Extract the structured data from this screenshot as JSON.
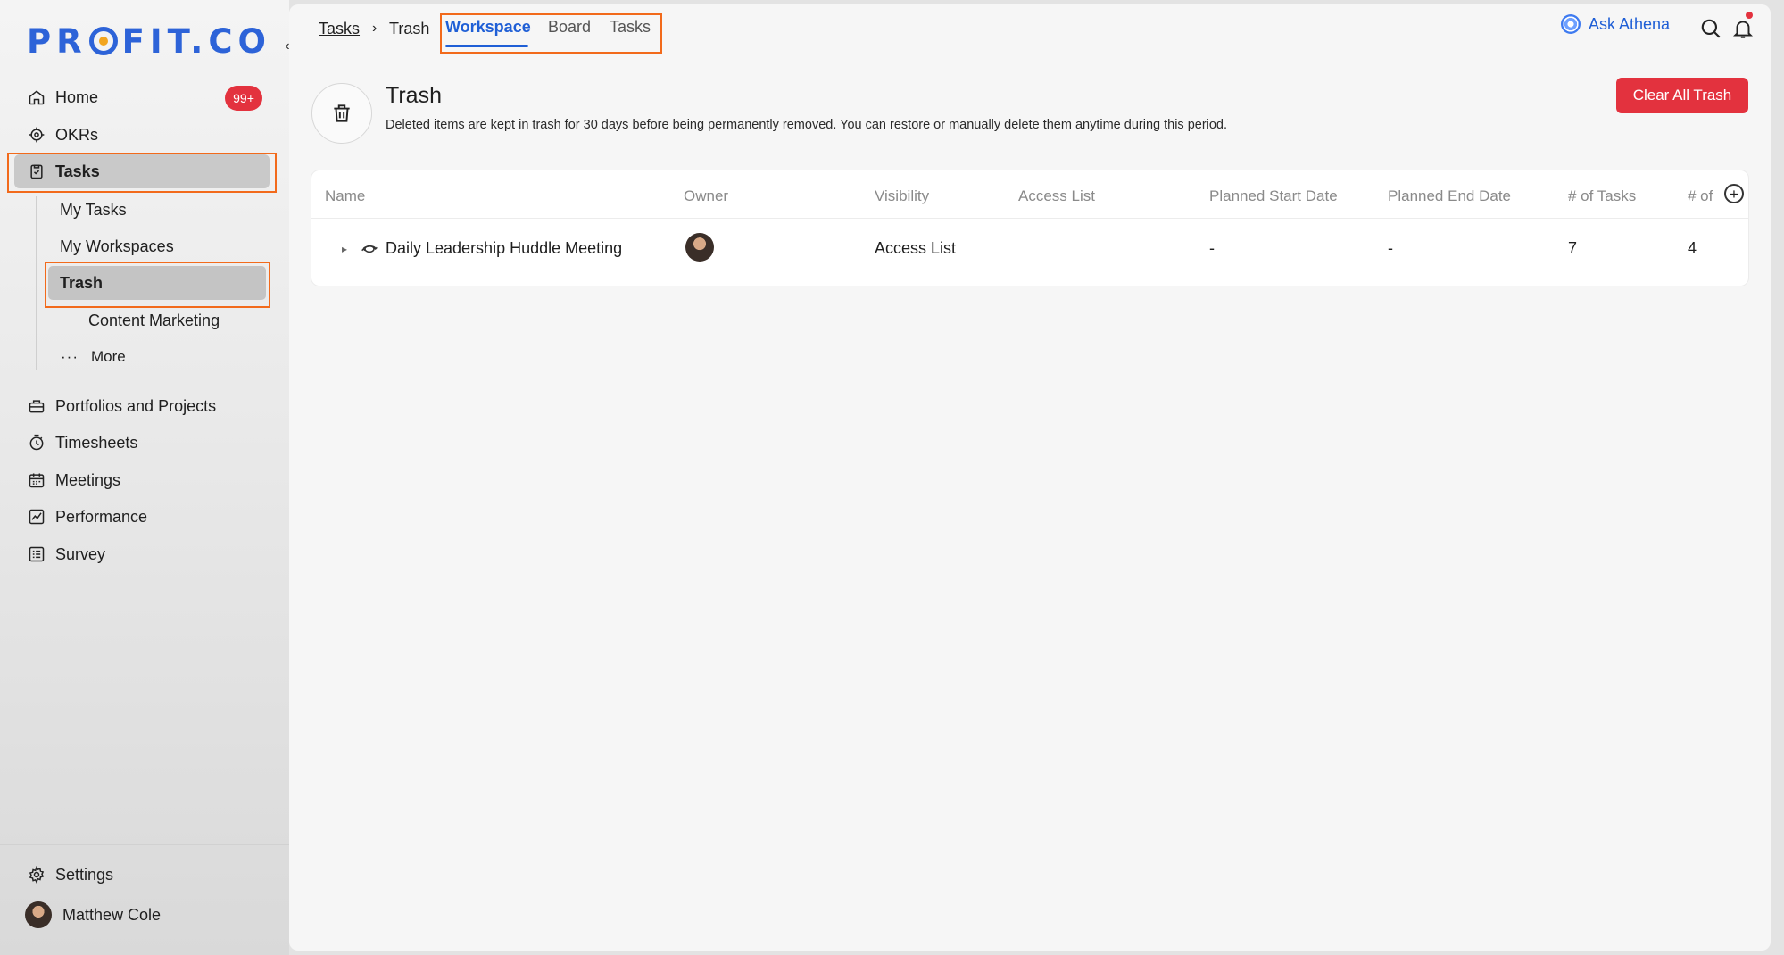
{
  "brand": {
    "logo_pre": "PR",
    "logo_post": "FIT.CO"
  },
  "sidebar": {
    "collapse": "‹",
    "items": [
      {
        "label": "Home",
        "icon": "home-icon",
        "badge": "99+"
      },
      {
        "label": "OKRs",
        "icon": "target-icon"
      },
      {
        "label": "Tasks",
        "icon": "clipboard-check-icon"
      }
    ],
    "task_subitems": [
      {
        "label": "My Tasks"
      },
      {
        "label": "My Workspaces"
      },
      {
        "label": "Trash"
      },
      {
        "label": "Content Marketing"
      },
      {
        "label": "More"
      }
    ],
    "more_items": [
      {
        "label": "Portfolios and Projects",
        "icon": "briefcase-icon"
      },
      {
        "label": "Timesheets",
        "icon": "stopwatch-icon"
      },
      {
        "label": "Meetings",
        "icon": "calendar-icon"
      },
      {
        "label": "Performance",
        "icon": "chart-line-icon"
      },
      {
        "label": "Survey",
        "icon": "survey-icon"
      }
    ],
    "settings": "Settings",
    "user": "Matthew Cole"
  },
  "topbar": {
    "breadcrumb": {
      "root": "Tasks",
      "separator": "›",
      "current": "Trash"
    },
    "tabs": [
      {
        "label": "Workspace",
        "active": true
      },
      {
        "label": "Board"
      },
      {
        "label": "Tasks"
      }
    ],
    "ask_athena": "Ask Athena"
  },
  "page": {
    "title": "Trash",
    "description": "Deleted items are kept in trash for 30 days before being permanently removed. You can restore or manually delete them anytime during this period.",
    "clear_all": "Clear All Trash"
  },
  "table": {
    "columns": [
      "Name",
      "Owner",
      "Visibility",
      "Access List",
      "Planned Start Date",
      "Planned End Date",
      "# of Tasks",
      "# of"
    ],
    "add_column": "+",
    "rows": [
      {
        "name": "Daily Leadership Huddle Meeting",
        "visibility": "Access List",
        "access_list": "",
        "planned_start": "-",
        "planned_end": "-",
        "tasks": "7",
        "extra": "4"
      }
    ]
  },
  "colors": {
    "accent": "#1f5fd6",
    "danger": "#e3323e",
    "highlight": "#f26a1b"
  }
}
